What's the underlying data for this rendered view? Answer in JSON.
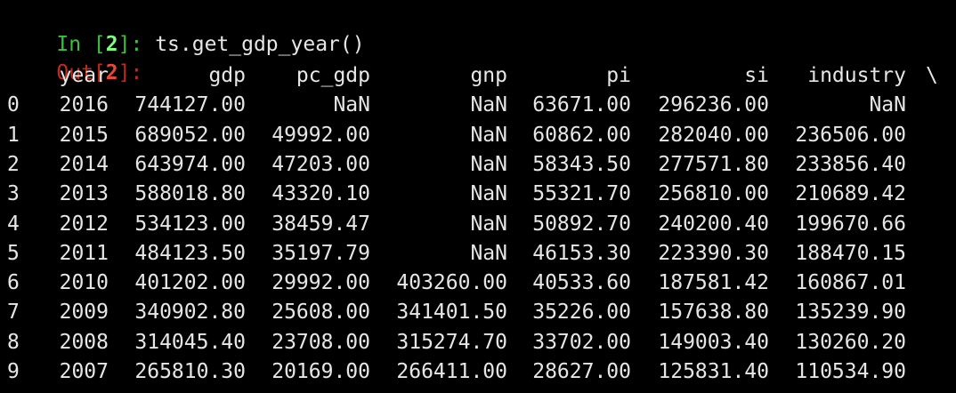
{
  "input": {
    "prompt_prefix": "In [",
    "prompt_number": "2",
    "prompt_suffix": "]: ",
    "code": "ts.get_gdp_year()"
  },
  "output": {
    "prompt_prefix": "Out[",
    "prompt_number": "2",
    "prompt_suffix": "]:"
  },
  "table": {
    "columns": [
      "year",
      "gdp",
      "pc_gdp",
      "gnp",
      "pi",
      "si",
      "industry"
    ],
    "continuation": "\\",
    "rows": [
      {
        "index": "0",
        "year": "2016",
        "gdp": "744127.00",
        "pc_gdp": "NaN",
        "gnp": "NaN",
        "pi": "63671.00",
        "si": "296236.00",
        "industry": "NaN"
      },
      {
        "index": "1",
        "year": "2015",
        "gdp": "689052.00",
        "pc_gdp": "49992.00",
        "gnp": "NaN",
        "pi": "60862.00",
        "si": "282040.00",
        "industry": "236506.00"
      },
      {
        "index": "2",
        "year": "2014",
        "gdp": "643974.00",
        "pc_gdp": "47203.00",
        "gnp": "NaN",
        "pi": "58343.50",
        "si": "277571.80",
        "industry": "233856.40"
      },
      {
        "index": "3",
        "year": "2013",
        "gdp": "588018.80",
        "pc_gdp": "43320.10",
        "gnp": "NaN",
        "pi": "55321.70",
        "si": "256810.00",
        "industry": "210689.42"
      },
      {
        "index": "4",
        "year": "2012",
        "gdp": "534123.00",
        "pc_gdp": "38459.47",
        "gnp": "NaN",
        "pi": "50892.70",
        "si": "240200.40",
        "industry": "199670.66"
      },
      {
        "index": "5",
        "year": "2011",
        "gdp": "484123.50",
        "pc_gdp": "35197.79",
        "gnp": "NaN",
        "pi": "46153.30",
        "si": "223390.30",
        "industry": "188470.15"
      },
      {
        "index": "6",
        "year": "2010",
        "gdp": "401202.00",
        "pc_gdp": "29992.00",
        "gnp": "403260.00",
        "pi": "40533.60",
        "si": "187581.42",
        "industry": "160867.01"
      },
      {
        "index": "7",
        "year": "2009",
        "gdp": "340902.80",
        "pc_gdp": "25608.00",
        "gnp": "341401.50",
        "pi": "35226.00",
        "si": "157638.80",
        "industry": "135239.90"
      },
      {
        "index": "8",
        "year": "2008",
        "gdp": "314045.40",
        "pc_gdp": "23708.00",
        "gnp": "315274.70",
        "pi": "33702.00",
        "si": "149003.40",
        "industry": "130260.20"
      },
      {
        "index": "9",
        "year": "2007",
        "gdp": "265810.30",
        "pc_gdp": "20169.00",
        "gnp": "266411.00",
        "pi": "28627.00",
        "si": "125831.40",
        "industry": "110534.90"
      }
    ]
  },
  "colors": {
    "background": "#000000",
    "text": "#e6e6e6",
    "in_prompt": "#3fbf3f",
    "out_prompt": "#c02a1a"
  }
}
